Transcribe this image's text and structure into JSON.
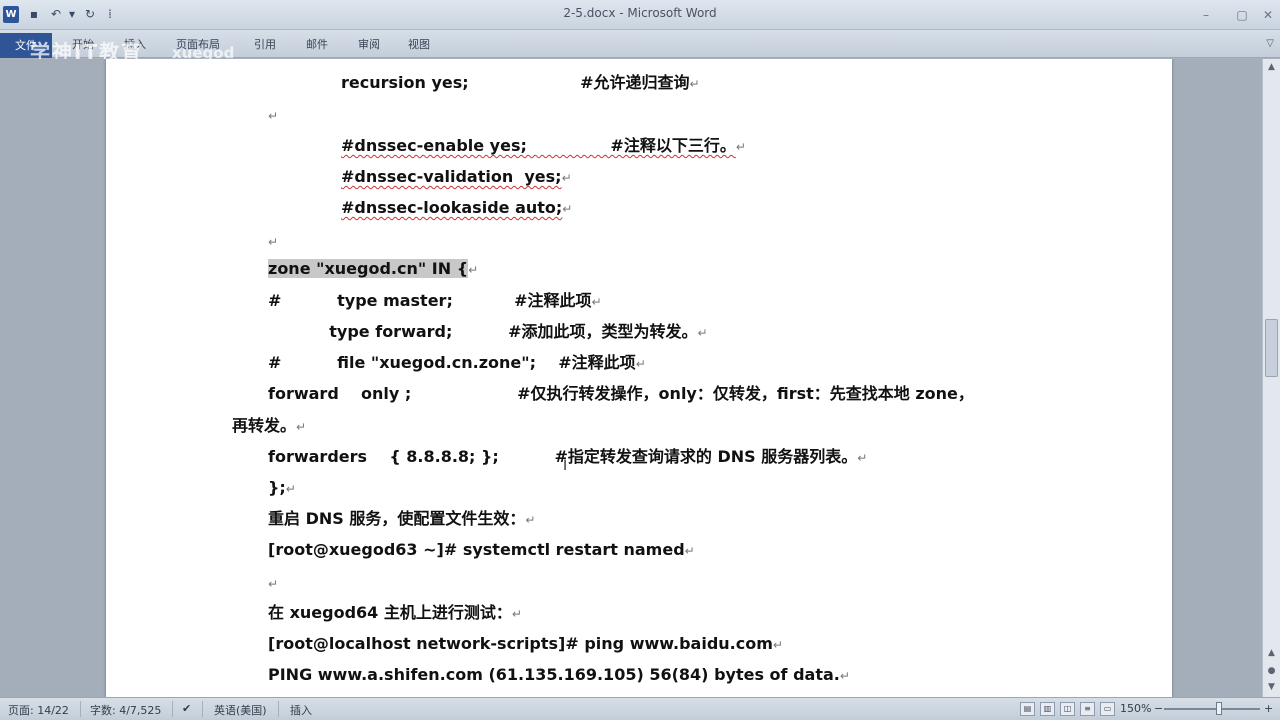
{
  "window": {
    "title": "2-5.docx - Microsoft Word",
    "app_icon": "W",
    "quick_access": [
      "save-icon",
      "undo-icon",
      "dropdown-icon",
      "redo-icon",
      "customize-icon"
    ],
    "controls": [
      "minimize-icon",
      "maximize-icon",
      "close-icon"
    ]
  },
  "ribbon": {
    "file_tab": "文件",
    "tabs": [
      "开始",
      "插入",
      "页面布局",
      "引用",
      "邮件",
      "审阅",
      "视图"
    ]
  },
  "watermark": {
    "text": "学神IT教育",
    "sub": "xuegod"
  },
  "document": {
    "lines": [
      {
        "text": "recursion yes;                    #允许递归查询",
        "mark": "↵"
      },
      {
        "text": "",
        "mark": "↵"
      },
      {
        "text": "#dnssec-enable yes;               #注释以下三行。",
        "mark": "↵"
      },
      {
        "text": "#dnssec-validation  yes;",
        "mark": "↵"
      },
      {
        "text": "#dnssec-lookaside auto;",
        "mark": "↵"
      },
      {
        "text": "",
        "mark": "↵"
      },
      {
        "text": "zone \"xuegod.cn\" IN {",
        "mark": "↵"
      },
      {
        "text": "#          type master;           #注释此项",
        "mark": "↵"
      },
      {
        "text": "           type forward;          #添加此项，类型为转发。",
        "mark": "↵"
      },
      {
        "text": "#          file \"xuegod.cn.zone\";    #注释此项",
        "mark": "↵"
      },
      {
        "text": "forward    only ;                   #仅执行转发操作，only：仅转发，first：先查找本地 zone，",
        "mark": ""
      },
      {
        "text": "再转发。",
        "mark": "↵"
      },
      {
        "text": "forwarders    { 8.8.8.8; };          #指定转发查询请求的 DNS 服务器列表。",
        "mark": "↵"
      },
      {
        "text": "};",
        "mark": "↵"
      },
      {
        "text": "重启 DNS 服务，使配置文件生效：",
        "mark": "↵"
      },
      {
        "text": "[root@xuegod63 ~]# systemctl restart named",
        "mark": "↵"
      },
      {
        "text": "",
        "mark": "↵"
      },
      {
        "text": "在 xuegod64 主机上进行测试：",
        "mark": "↵"
      },
      {
        "text": "[root@localhost network-scripts]# ping www.baidu.com",
        "mark": "↵"
      },
      {
        "text": "PING www.a.shifen.com (61.135.169.105) 56(84) bytes of data.",
        "mark": "↵"
      }
    ]
  },
  "status": {
    "page": "页面: 14/22",
    "words": "字数: 4/7,525",
    "language": "英语(美国)",
    "mode": "插入",
    "zoom": "150%",
    "proof_icon": "proofing-icon"
  }
}
